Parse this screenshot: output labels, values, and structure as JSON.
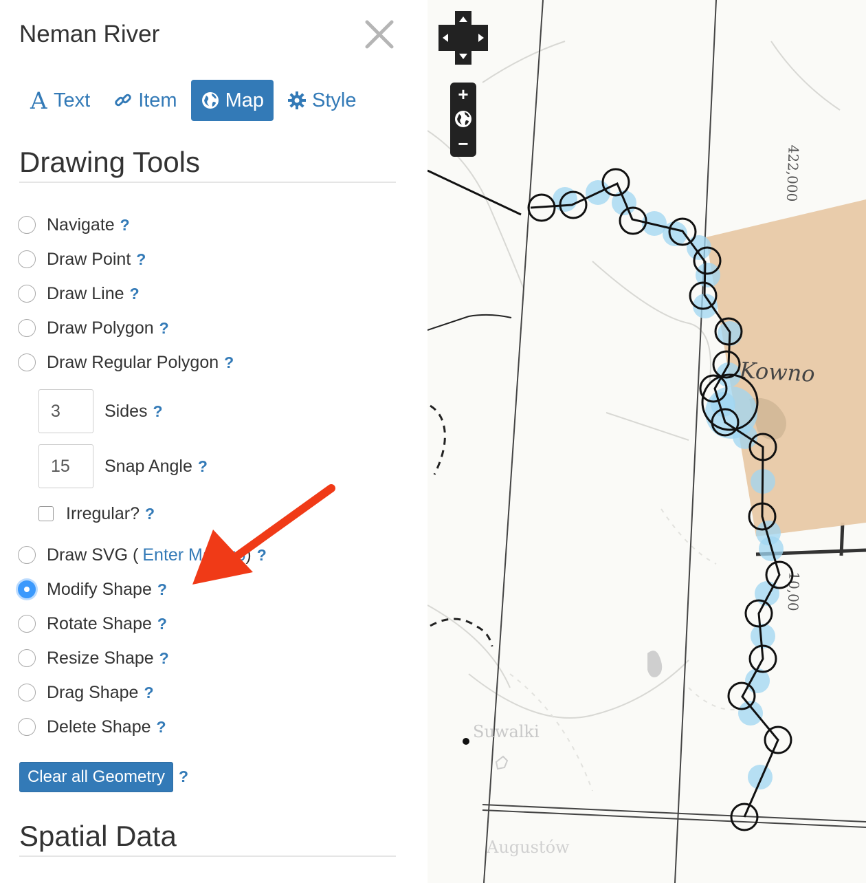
{
  "panel": {
    "title": "Neman River",
    "tabs": [
      {
        "label": "Text",
        "icon": "text-icon"
      },
      {
        "label": "Item",
        "icon": "link-icon"
      },
      {
        "label": "Map",
        "icon": "globe-icon",
        "active": true
      },
      {
        "label": "Style",
        "icon": "gear-icon"
      }
    ],
    "drawing_tools_heading": "Drawing Tools",
    "tools": [
      {
        "label": "Navigate",
        "checked": false
      },
      {
        "label": "Draw Point",
        "checked": false
      },
      {
        "label": "Draw Line",
        "checked": false
      },
      {
        "label": "Draw Polygon",
        "checked": false
      },
      {
        "label": "Draw Regular Polygon",
        "checked": false
      }
    ],
    "sides": {
      "label": "Sides",
      "value": "3"
    },
    "snap_angle": {
      "label": "Snap Angle",
      "value": "15"
    },
    "irregular": {
      "label": "Irregular?",
      "checked": false
    },
    "draw_svg": {
      "label_prefix": "Draw SVG (",
      "link": "Enter Markup",
      "label_suffix": ")"
    },
    "shape_tools": [
      {
        "label": "Modify Shape",
        "checked": true
      },
      {
        "label": "Rotate Shape",
        "checked": false
      },
      {
        "label": "Resize Shape",
        "checked": false
      },
      {
        "label": "Drag Shape",
        "checked": false
      },
      {
        "label": "Delete Shape",
        "checked": false
      }
    ],
    "help_mark": "?",
    "clear_button": "Clear all Geometry",
    "spatial_heading": "Spatial Data"
  },
  "map": {
    "labels": {
      "kowno": "Kowno",
      "suwalki": "Suwalki",
      "augustow": "Augustów",
      "scale_top": "422,000",
      "scale_mid": "10,00"
    },
    "zoom_in": "+",
    "zoom_out": "−",
    "colors": {
      "polygon_fill": "#e8c9a6",
      "vertex_fill": "#9fd6f2",
      "accent": "#337ab7",
      "arrow": "#f03a17"
    }
  }
}
